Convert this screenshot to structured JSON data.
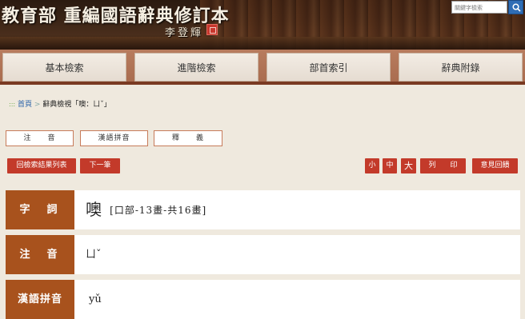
{
  "header": {
    "title": "教育部 重編國語辭典修訂本",
    "signature": "李登輝",
    "search_placeholder": "關鍵字檢索",
    "search_icon": "search-icon"
  },
  "menu": [
    "基本檢索",
    "進階檢索",
    "部首索引",
    "辭典附錄"
  ],
  "breadcrumb": {
    "prefix": ":::",
    "home": "首頁",
    "separator": ">",
    "current": "辭典檢視「噢：ㄩˇ」"
  },
  "tabs": [
    "注　　音",
    "漢語拼音",
    "釋　　義"
  ],
  "buttons": {
    "back_to_results": "回檢索結果列表",
    "next": "下一筆",
    "font_small": "小",
    "font_medium": "中",
    "font_large": "大",
    "print": "列　　印",
    "feedback": "意見回饋"
  },
  "entry": {
    "word_label": "字　詞",
    "word": "噢",
    "radical_info": "[口部-13畫-共16畫]",
    "zhuyin_label": "注　音",
    "zhuyin": "ㄩˇ",
    "pinyin_label": "漢語拼音",
    "pinyin": "yǔ"
  },
  "colors": {
    "accent_red": "#c33a2a",
    "label_brown": "#a8521d",
    "menu_bar": "#b87c5e",
    "page_bg": "#efe9de"
  }
}
